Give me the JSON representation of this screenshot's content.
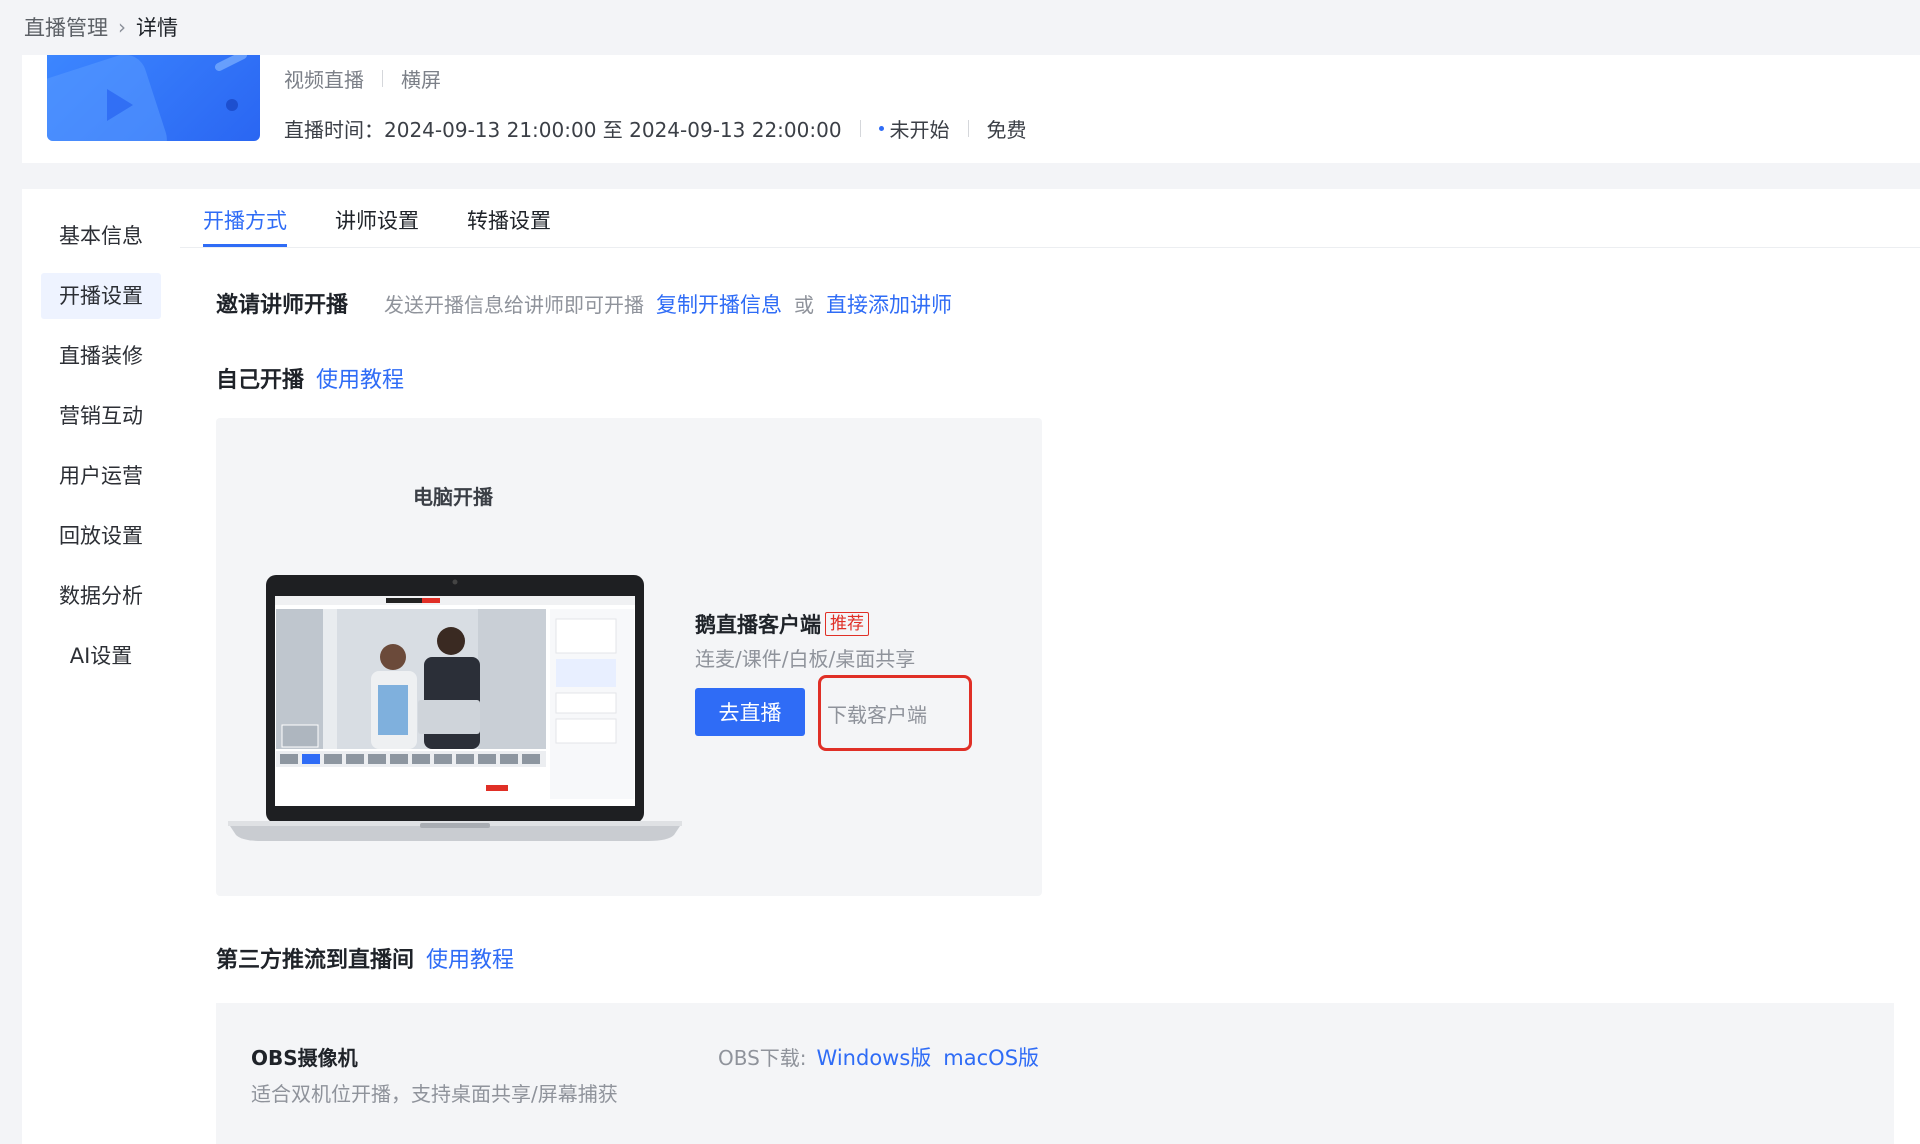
{
  "breadcrumb": {
    "parent": "直播管理",
    "current": "详情"
  },
  "header": {
    "type": "视频直播",
    "orientation": "横屏",
    "time_label": "直播时间：",
    "time_value": "2024-09-13 21:00:00 至 2024-09-13 22:00:00",
    "status": "未开始",
    "price": "免费"
  },
  "sidebar": {
    "items": [
      {
        "label": "基本信息"
      },
      {
        "label": "开播设置",
        "active": true
      },
      {
        "label": "直播装修"
      },
      {
        "label": "营销互动"
      },
      {
        "label": "用户运营"
      },
      {
        "label": "回放设置"
      },
      {
        "label": "数据分析"
      },
      {
        "label": "AI设置"
      }
    ]
  },
  "tabs": [
    {
      "label": "开播方式",
      "active": true
    },
    {
      "label": "讲师设置"
    },
    {
      "label": "转播设置"
    }
  ],
  "invite": {
    "title": "邀请讲师开播",
    "desc": "发送开播信息给讲师即可开播",
    "copy_link": "复制开播信息",
    "or": "或",
    "add_link": "直接添加讲师"
  },
  "self": {
    "title": "自己开播",
    "tutorial": "使用教程",
    "pc_title": "电脑开播",
    "client_name": "鹅直播客户端",
    "recommend_tag": "推荐",
    "features": "连麦/课件/白板/桌面共享",
    "go_button": "去直播",
    "download_button": "下载客户端"
  },
  "third_party": {
    "title": "第三方推流到直播间",
    "tutorial": "使用教程",
    "obs_title": "OBS摄像机",
    "obs_desc": "适合双机位开播，支持桌面共享/屏幕捕获",
    "obs_download_label": "OBS下载:",
    "windows": "Windows版",
    "macos": "macOS版"
  },
  "colors": {
    "accent": "#2f6cf6",
    "highlight": "#e02f26"
  }
}
